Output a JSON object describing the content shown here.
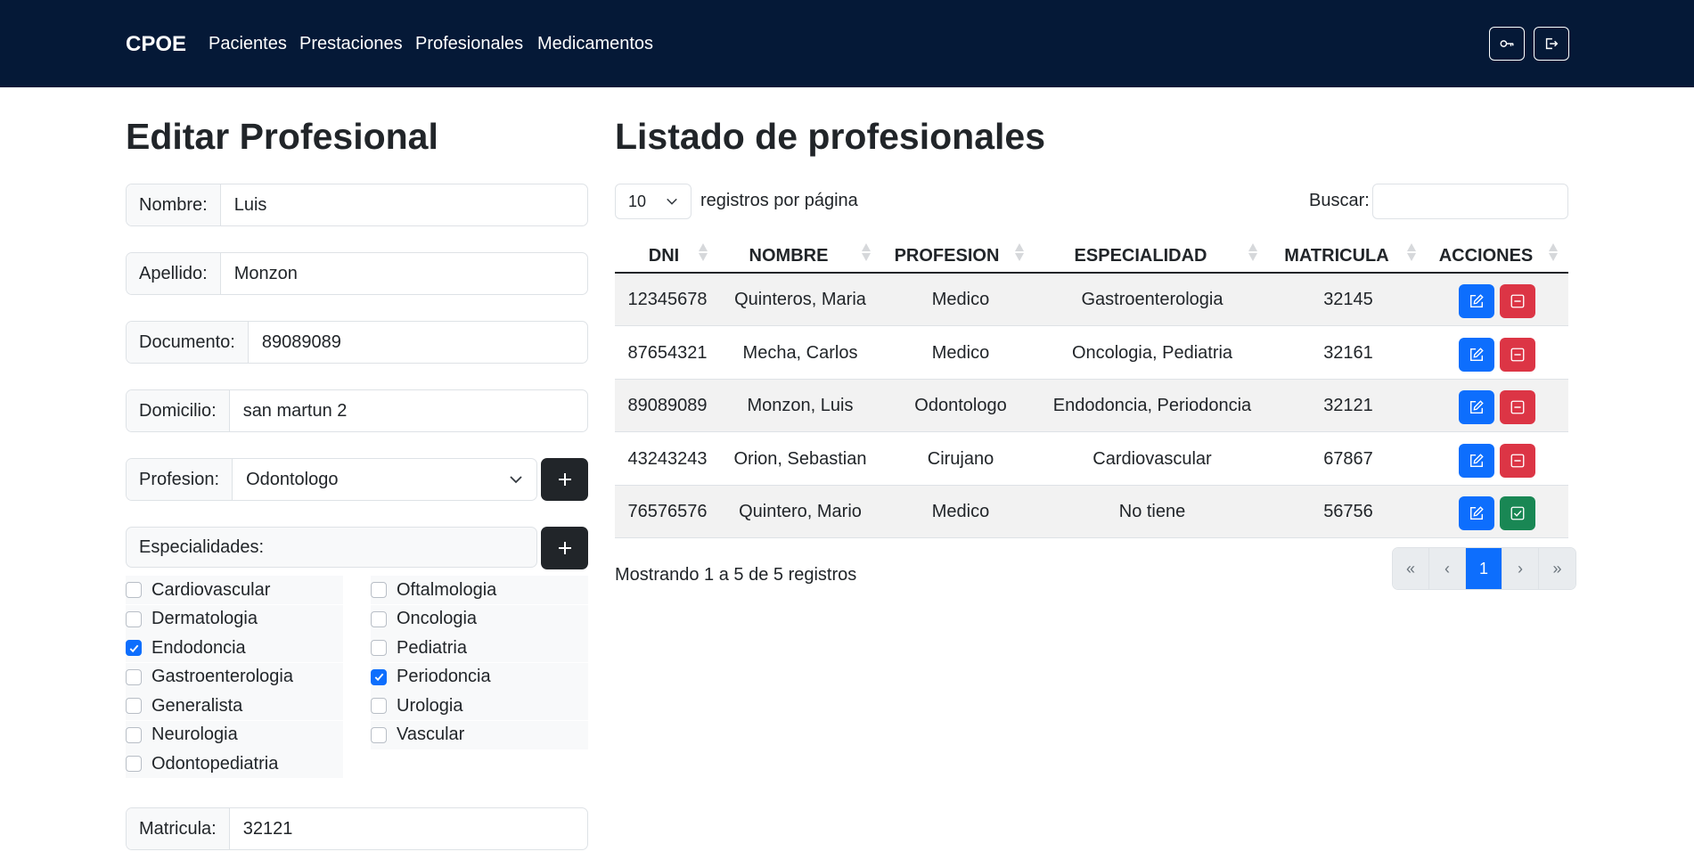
{
  "navbar": {
    "brand": "CPOE",
    "links": [
      "Pacientes",
      "Prestaciones",
      "Profesionales",
      "Medicamentos"
    ],
    "icons": [
      "key-icon",
      "logout-icon"
    ]
  },
  "form": {
    "title": "Editar Profesional",
    "nombre": {
      "label": "Nombre:",
      "value": "Luis"
    },
    "apellido": {
      "label": "Apellido:",
      "value": "Monzon"
    },
    "documento": {
      "label": "Documento:",
      "value": "89089089"
    },
    "domicilio": {
      "label": "Domicilio:",
      "value": "san martun 2"
    },
    "profesion": {
      "label": "Profesion:",
      "value": "Odontologo"
    },
    "especialidades_label": "Especialidades:",
    "especialidades": [
      {
        "label": "Cardiovascular",
        "checked": false
      },
      {
        "label": "Oftalmologia",
        "checked": false
      },
      {
        "label": "Dermatologia",
        "checked": false
      },
      {
        "label": "Oncologia",
        "checked": false
      },
      {
        "label": "Endodoncia",
        "checked": true
      },
      {
        "label": "Pediatria",
        "checked": false
      },
      {
        "label": "Gastroenterologia",
        "checked": false
      },
      {
        "label": "Periodoncia",
        "checked": true
      },
      {
        "label": "Generalista",
        "checked": false
      },
      {
        "label": "Urologia",
        "checked": false
      },
      {
        "label": "Neurologia",
        "checked": false
      },
      {
        "label": "Vascular",
        "checked": false
      },
      {
        "label": "Odontopediatria",
        "checked": false
      }
    ],
    "matricula": {
      "label": "Matricula:",
      "value": "32121"
    }
  },
  "listado": {
    "title": "Listado de profesionales",
    "page_size": "10",
    "page_size_label": "registros por página",
    "search_label": "Buscar:",
    "search_value": "",
    "headers": [
      "DNI",
      "NOMBRE",
      "PROFESION",
      "ESPECIALIDAD",
      "MATRICULA",
      "ACCIONES"
    ],
    "rows": [
      {
        "dni": "12345678",
        "nombre": "Quinteros, Maria",
        "profesion": "Medico",
        "especialidad": "Gastroenterologia",
        "matricula": "32145",
        "active": true
      },
      {
        "dni": "87654321",
        "nombre": "Mecha, Carlos",
        "profesion": "Medico",
        "especialidad": "Oncologia, Pediatria",
        "matricula": "32161",
        "active": true
      },
      {
        "dni": "89089089",
        "nombre": "Monzon, Luis",
        "profesion": "Odontologo",
        "especialidad": "Endodoncia, Periodoncia",
        "matricula": "32121",
        "active": true
      },
      {
        "dni": "43243243",
        "nombre": "Orion, Sebastian",
        "profesion": "Cirujano",
        "especialidad": "Cardiovascular",
        "matricula": "67867",
        "active": true
      },
      {
        "dni": "76576576",
        "nombre": "Quintero, Mario",
        "profesion": "Medico",
        "especialidad": "No tiene",
        "matricula": "56756",
        "active": false
      }
    ],
    "showing": "Mostrando 1 a 5 de 5 registros",
    "pagination": {
      "first": "«",
      "prev": "‹",
      "current": "1",
      "next": "›",
      "last": "»"
    }
  },
  "colors": {
    "navbar": "#051937",
    "primary": "#0d6efd",
    "danger": "#dc3545",
    "success": "#198754",
    "dark": "#212529"
  }
}
